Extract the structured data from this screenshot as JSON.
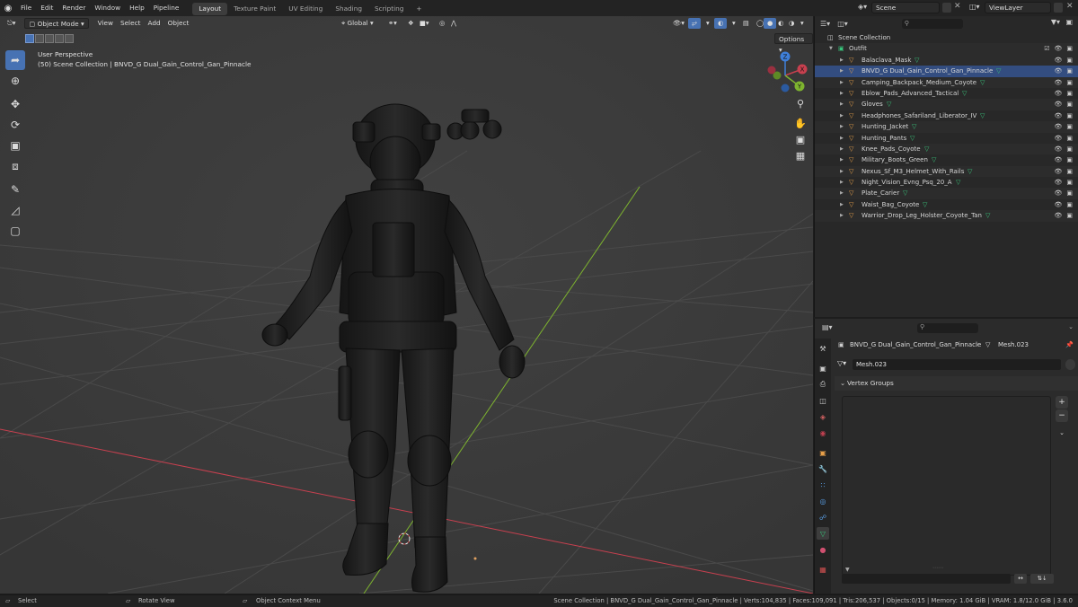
{
  "menu": {
    "items": [
      "File",
      "Edit",
      "Render",
      "Window",
      "Help",
      "Pipeline"
    ],
    "workspaces": [
      "Layout",
      "Texture Paint",
      "UV Editing",
      "Shading",
      "Scripting"
    ],
    "active_workspace": "Layout",
    "add_tab": "+"
  },
  "scene": {
    "name": "Scene",
    "view_layer": "ViewLayer"
  },
  "viewport": {
    "mode": "Object Mode",
    "menus": [
      "View",
      "Select",
      "Add",
      "Object"
    ],
    "orientation": "Global",
    "options_label": "Options",
    "perspective": "User Perspective",
    "context": "(50) Scene Collection | BNVD_G Dual_Gain_Control_Gan_Pinnacle",
    "gizmo": {
      "x": "X",
      "y": "Y",
      "z": "Z"
    }
  },
  "outliner": {
    "root": "Scene Collection",
    "collection": "Outfit",
    "items": [
      "Balaclava_Mask",
      "BNVD_G Dual_Gain_Control_Gan_Pinnacle",
      "Camping_Backpack_Medium_Coyote",
      "Eblow_Pads_Advanced_Tactical",
      "Gloves",
      "Headphones_Safariland_Liberator_IV",
      "Hunting_Jacket",
      "Hunting_Pants",
      "Knee_Pads_Coyote",
      "Military_Boots_Green",
      "Nexus_Sf_M3_Helmet_With_Rails",
      "Night_Vision_Evng_Psq_20_A",
      "Plate_Carier",
      "Waist_Bag_Coyote",
      "Warrior_Drop_Leg_Holster_Coyote_Tan"
    ],
    "selected_index": 1
  },
  "properties": {
    "object_name": "BNVD_G Dual_Gain_Control_Gan_Pinnacle",
    "mesh_name": "Mesh.023",
    "mesh_field": "Mesh.023",
    "panel_title": "Vertex Groups"
  },
  "statusbar": {
    "select": "Select",
    "rotate": "Rotate View",
    "context_menu": "Object Context Menu",
    "stats": "Scene Collection | BNVD_G Dual_Gain_Control_Gan_Pinnacle | Verts:104,835 | Faces:109,091 | Tris:206,537 | Objects:0/15 | Memory: 1.04 GiB | VRAM: 1.8/12.0 GiB | 3.6.0"
  },
  "colors": {
    "accent": "#4772b3",
    "mesh_icon": "#38c47a",
    "object_icon": "#e8a04a",
    "x_axis": "#c8404f",
    "y_axis": "#7eb42f",
    "z_axis": "#3f7fd8"
  }
}
